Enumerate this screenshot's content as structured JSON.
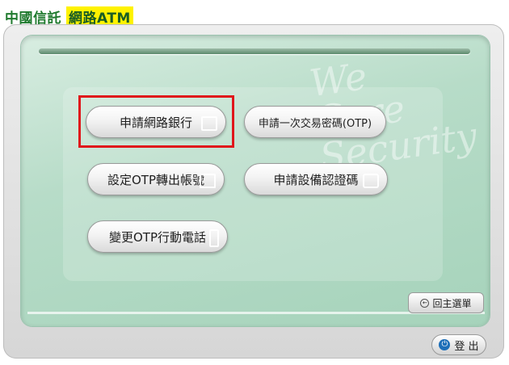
{
  "header": {
    "brand_part1": "中國信託",
    "brand_part2": "網路ATM"
  },
  "watermark": {
    "text": "We Care Security"
  },
  "menu": {
    "apply_online_banking": "申請網路銀行",
    "apply_otp": "申請一次交易密碼(OTP)",
    "set_otp_account": "設定OTP轉出帳號",
    "apply_device_cert": "申請設備認證碼",
    "change_otp_phone": "變更OTP行動電話"
  },
  "navigation": {
    "home_label": "回主選單",
    "logout_label": "登 出"
  },
  "colors": {
    "brand_green": "#1f7a2e",
    "brand_highlight": "#fff200",
    "panel_green": "#b7dcc8",
    "selection_outline": "#e0161b"
  }
}
